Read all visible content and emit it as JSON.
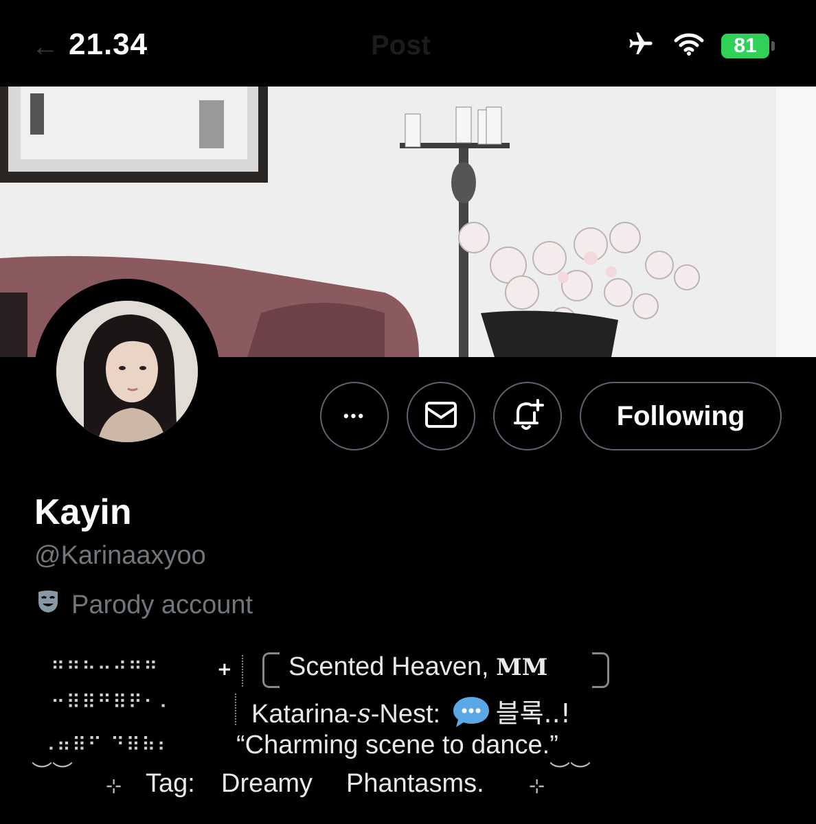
{
  "status_bar": {
    "time": "21.34",
    "battery_level": "81",
    "back_glyph": "←",
    "faded_title": "Post",
    "icons": [
      "airplane-icon",
      "wifi-icon",
      "battery-icon"
    ]
  },
  "profile": {
    "display_name": "Kayin",
    "handle": "@Karinaaxyoo",
    "parody_label": "Parody account"
  },
  "actions": {
    "more_glyph": "•••",
    "following_label": "Following"
  },
  "bio": {
    "braille_1": "⠶⠶⠦⠤⠴⠶⠶",
    "braille_2": "⠒⠿⠿⠛⠿⠟⠂⠄",
    "braille_3": "⠠⠶⠿⠋ ⠙⠿⠷⠆",
    "plus": "+",
    "line1_text": "Scented Heaven, ",
    "line1_bold": "MM",
    "line2_prefix": "Katarina-",
    "line2_italic": "s",
    "line2_mid": "-Nest: ",
    "line2_korean": "블록..!",
    "line3": "“Charming scene to dance.”",
    "line4_tag": "Tag:",
    "line4_word1": "Dreamy",
    "line4_word2": "Phantasms.",
    "sparkle": "⊹",
    "swoosh": "︶︶"
  },
  "colors": {
    "background": "#000000",
    "muted_text": "#71767b",
    "button_border": "#5b6570",
    "battery_green": "#30d158"
  }
}
